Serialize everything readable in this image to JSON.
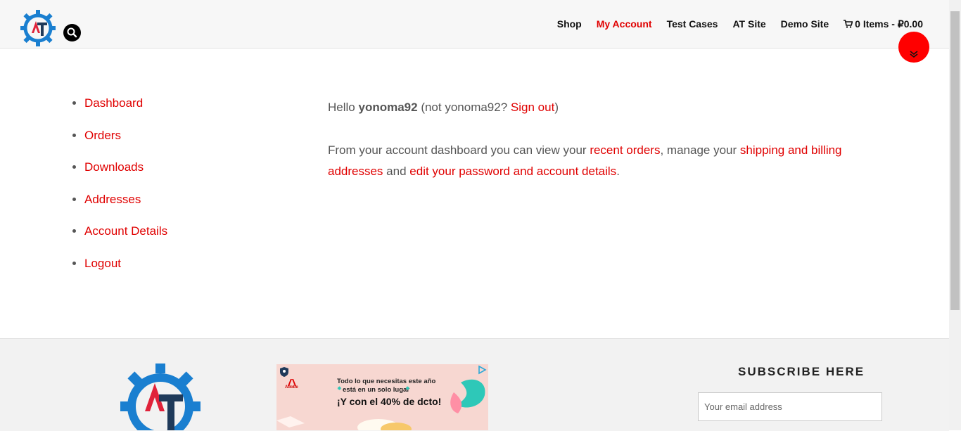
{
  "nav": {
    "items": [
      "Shop",
      "My Account",
      "Test Cases",
      "AT Site",
      "Demo Site"
    ],
    "cart_label": "0 Items - ₽0.00"
  },
  "sidebar": {
    "items": [
      "Dashboard",
      "Orders",
      "Downloads",
      "Addresses",
      "Account Details",
      "Logout"
    ]
  },
  "content": {
    "hello": "Hello",
    "username": "yonoma92",
    "not_text": "(not yonoma92?",
    "sign_out": "Sign out",
    "close_paren": ")",
    "p2_a": "From your account dashboard you can view your",
    "recent_orders": "recent orders",
    "p2_b": ", manage your",
    "addresses_link": "shipping and billing addresses",
    "p2_c": "and",
    "account_link": "edit your password and account details",
    "p2_d": "."
  },
  "ad": {
    "brand": "Adobe",
    "line1": "Todo lo que necesitas este año",
    "line2": "está en un solo lugar",
    "line3": "¡Y con el 40% de dcto!"
  },
  "footer": {
    "subscribe_title": "SUBSCRIBE HERE",
    "email_placeholder": "Your email address"
  },
  "colors": {
    "accent": "#e00000",
    "logo_blue": "#1a7fd0",
    "logo_navy": "#1f3a5a"
  }
}
